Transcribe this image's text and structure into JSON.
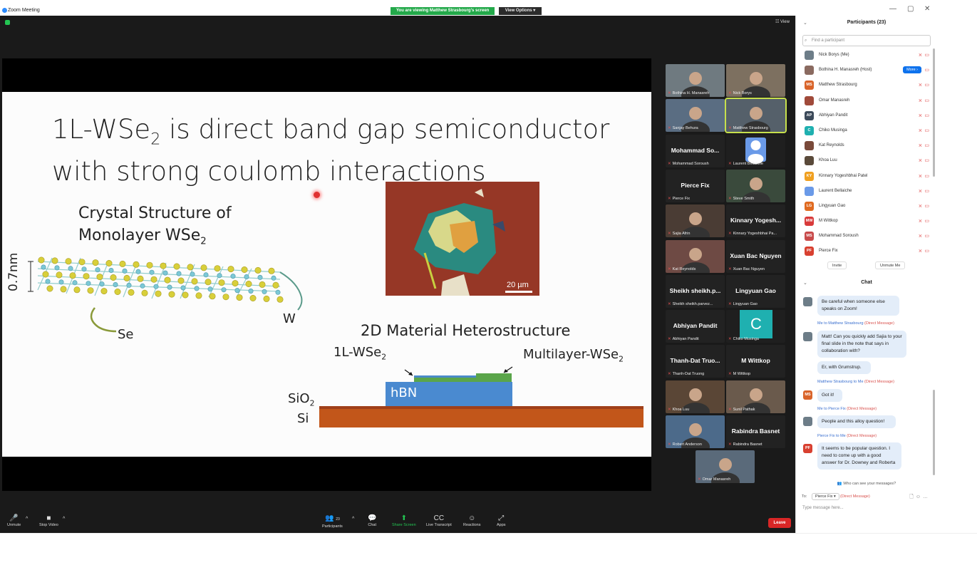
{
  "window": {
    "title": "Zoom Meeting",
    "controls": [
      "—",
      "▢",
      "✕"
    ]
  },
  "share": {
    "banner": "You are viewing Matthew Strasbourg's screen",
    "view_options": "View Options ▾",
    "view_label": "View"
  },
  "slide": {
    "title_pre": "1L-WSe",
    "title_sub": "2",
    "title_rest": " is direct band gap semiconductor",
    "title_line2": "with strong coulomb interactions",
    "crystal_title_line1": "Crystal Structure of",
    "crystal_title_line2_pre": "Monolayer WSe",
    "crystal_title_sub": "2",
    "thickness_label": "0.7nm",
    "se_label": "Se",
    "w_label": "W",
    "scale_label": "20 µm",
    "hetero_title": "2D Material Heterostructure",
    "mono_label_pre": "1L-WSe",
    "mono_label_sub": "2",
    "multi_label_pre": "Multilayer-WSe",
    "multi_label_sub": "2",
    "hbn_label": "hBN",
    "sio2_pre": "SiO",
    "sio2_sub": "2",
    "si_label": "Si"
  },
  "gallery": [
    {
      "name": "Bothina H. Manasreh",
      "type": "video",
      "color": "#6f7a80"
    },
    {
      "name": "Nick Borys",
      "type": "video",
      "color": "#7d7060"
    },
    {
      "name": "Sanjay Behura",
      "type": "video",
      "color": "#5a6d82"
    },
    {
      "name": "Matthew Strasbourg",
      "type": "video",
      "color": "#55606a",
      "active": true
    },
    {
      "name": "Mohammad Soroush",
      "big": "Mohammad So...",
      "type": "name"
    },
    {
      "name": "Laurent Bellaiche",
      "type": "avatar"
    },
    {
      "name": "Pierce Fix",
      "big": "Pierce Fix",
      "type": "name"
    },
    {
      "name": "Steve Smith",
      "type": "video",
      "color": "#3a4a3c"
    },
    {
      "name": "Sajia Afrin",
      "type": "video",
      "color": "#4a3c34"
    },
    {
      "name": "Kinnary Yogeshbhai Pa...",
      "big": "Kinnary Yogesh...",
      "type": "name"
    },
    {
      "name": "Kat Reynolds",
      "type": "video",
      "color": "#6e4a44"
    },
    {
      "name": "Xuan Bac Nguyen",
      "big": "Xuan Bac Nguyen",
      "type": "name"
    },
    {
      "name": "Sheikh sheikh.parvez...",
      "big": "Sheikh sheikh.p...",
      "type": "name"
    },
    {
      "name": "Lingyuan Gao",
      "big": "Lingyuan Gao",
      "type": "name"
    },
    {
      "name": "Abhiyan Pandit",
      "big": "Abhiyan Pandit",
      "type": "name"
    },
    {
      "name": "Chiko Musinga",
      "big": "C",
      "type": "letter"
    },
    {
      "name": "Thanh-Dat Truong",
      "big": "Thanh-Dat Truo...",
      "type": "name"
    },
    {
      "name": "M Wittkop",
      "big": "M Wittkop",
      "type": "name"
    },
    {
      "name": "Khoa Luu",
      "type": "video",
      "color": "#5a4636"
    },
    {
      "name": "Sunil Pathak",
      "type": "video",
      "color": "#6a5a4c"
    },
    {
      "name": "Robert Anderson",
      "type": "video",
      "color": "#4c6a8a"
    },
    {
      "name": "Rabindra Basnet",
      "big": "Rabindra Basnet",
      "type": "name"
    },
    {
      "name": "Omar Manasreh",
      "type": "video",
      "color": "#5a6a7a"
    }
  ],
  "toolbar": {
    "unmute": "Unmute",
    "stop_video": "Stop Video",
    "participants": "Participants",
    "participants_count": "23",
    "chat": "Chat",
    "share_screen": "Share Screen",
    "live_transcript": "Live Transcript",
    "reactions": "Reactions",
    "apps": "Apps",
    "leave": "Leave"
  },
  "participants_panel": {
    "title": "Participants (23)",
    "search_placeholder": "Find a participant",
    "more_button": "More ›",
    "invite": "Invite",
    "unmute_me": "Unmute Me",
    "items": [
      {
        "name": "Nick Borys (Me)",
        "initials": "",
        "color": "#6d7d88"
      },
      {
        "name": "Bothina H. Manasreh (Host)",
        "initials": "",
        "color": "#8a6a60"
      },
      {
        "name": "Matthew Strasbourg",
        "initials": "MS",
        "color": "#d9642a"
      },
      {
        "name": "Omar Manasreh",
        "initials": "",
        "color": "#a04a3a"
      },
      {
        "name": "Abhiyan Pandit",
        "initials": "AP",
        "color": "#3c4a5a"
      },
      {
        "name": "Chiko Musinga",
        "initials": "C",
        "color": "#1fb0b0"
      },
      {
        "name": "Kat Reynolds",
        "initials": "",
        "color": "#7a4a3a"
      },
      {
        "name": "Khoa Luu",
        "initials": "",
        "color": "#5a4a3a"
      },
      {
        "name": "Kinnary Yogeshbhai Patel",
        "initials": "KY",
        "color": "#f0a020"
      },
      {
        "name": "Laurent Bellaiche",
        "initials": "",
        "color": "#6a9ae8"
      },
      {
        "name": "Lingyuan Gao",
        "initials": "LG",
        "color": "#e06a20"
      },
      {
        "name": "M Wittkop",
        "initials": "MW",
        "color": "#d83a3a"
      },
      {
        "name": "Mohammad Soroush",
        "initials": "MS",
        "color": "#c84a4a"
      },
      {
        "name": "Pierce Fix",
        "initials": "PF",
        "color": "#d84030"
      }
    ]
  },
  "chat": {
    "title": "Chat",
    "partial_top": "",
    "messages": [
      {
        "meta_from": "",
        "meta_dm": "",
        "text": "Be careful when someone else speaks on Zoom!",
        "initials": "",
        "color": "#6d7d88"
      },
      {
        "meta_from": "Me to Matthew Strasbourg",
        "meta_dm": "(Direct Message)",
        "text": "Matt!  Can you quickly add Sajia to your final slide in the note that says in collaboration with?",
        "initials": "",
        "color": "#6d7d88"
      },
      {
        "meta_from": "",
        "meta_dm": "",
        "text": "Er, with Grumstrup.",
        "initials": "",
        "color": ""
      },
      {
        "meta_from": "Matthew Strasbourg to Me",
        "meta_dm": "(Direct Message)",
        "text": "Got it!",
        "initials": "MS",
        "color": "#d9642a"
      },
      {
        "meta_from": "Me to Pierce Fix",
        "meta_dm": "(Direct Message)",
        "text": "People and this alloy question!",
        "initials": "",
        "color": "#6d7d88"
      },
      {
        "meta_from": "Pierce Fix to Me",
        "meta_dm": "(Direct Message)",
        "text": "It seems to be popular question. I need to come up with a good answer for Dr. Downey and Roberta",
        "initials": "PF",
        "color": "#d84030"
      }
    ],
    "who_can_see": "Who can see your messages?",
    "to_label": "To:",
    "to_value": "Pierce Fix ▾",
    "to_dm": "(Direct Message)",
    "placeholder": "Type message here..."
  }
}
